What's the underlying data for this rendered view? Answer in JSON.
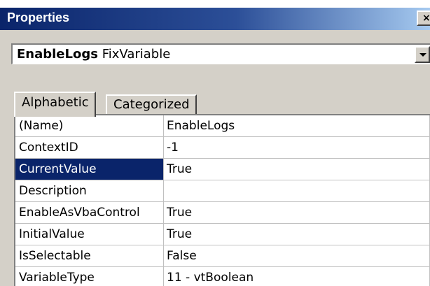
{
  "window": {
    "title": "Properties",
    "close_glyph": "×"
  },
  "object_selector": {
    "name": "EnableLogs",
    "type": "FixVariable"
  },
  "tabs": [
    {
      "label": "Alphabetic",
      "active": true
    },
    {
      "label": "Categorized",
      "active": false
    }
  ],
  "properties": [
    {
      "name": "(Name)",
      "value": "EnableLogs"
    },
    {
      "name": "ContextID",
      "value": "-1"
    },
    {
      "name": "CurrentValue",
      "value": "True",
      "selected": true
    },
    {
      "name": "Description",
      "value": ""
    },
    {
      "name": "EnableAsVbaControl",
      "value": "True"
    },
    {
      "name": "InitialValue",
      "value": "True"
    },
    {
      "name": "IsSelectable",
      "value": "False"
    },
    {
      "name": "VariableType",
      "value": "11 - vtBoolean"
    }
  ],
  "colors": {
    "title_bar": "#0a246a",
    "selection": "#0a246a",
    "window_face": "#d4d0c8"
  }
}
